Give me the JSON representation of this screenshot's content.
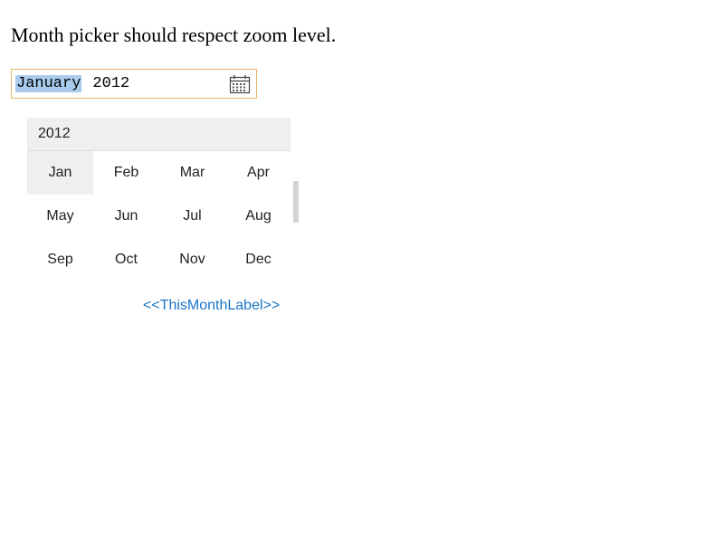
{
  "page": {
    "title": "Month picker should respect zoom level."
  },
  "month_input": {
    "month_value": "January",
    "year_value": "2012",
    "icon": "calendar-icon",
    "border_color": "#e4b76a",
    "selection_color": "#a9cbec"
  },
  "picker": {
    "year_header": "2012",
    "months": [
      "Jan",
      "Feb",
      "Mar",
      "Apr",
      "May",
      "Jun",
      "Jul",
      "Aug",
      "Sep",
      "Oct",
      "Nov",
      "Dec"
    ],
    "selected_month": "Jan",
    "this_month_label": "<<ThisMonthLabel>>",
    "link_color": "#1976c8"
  }
}
